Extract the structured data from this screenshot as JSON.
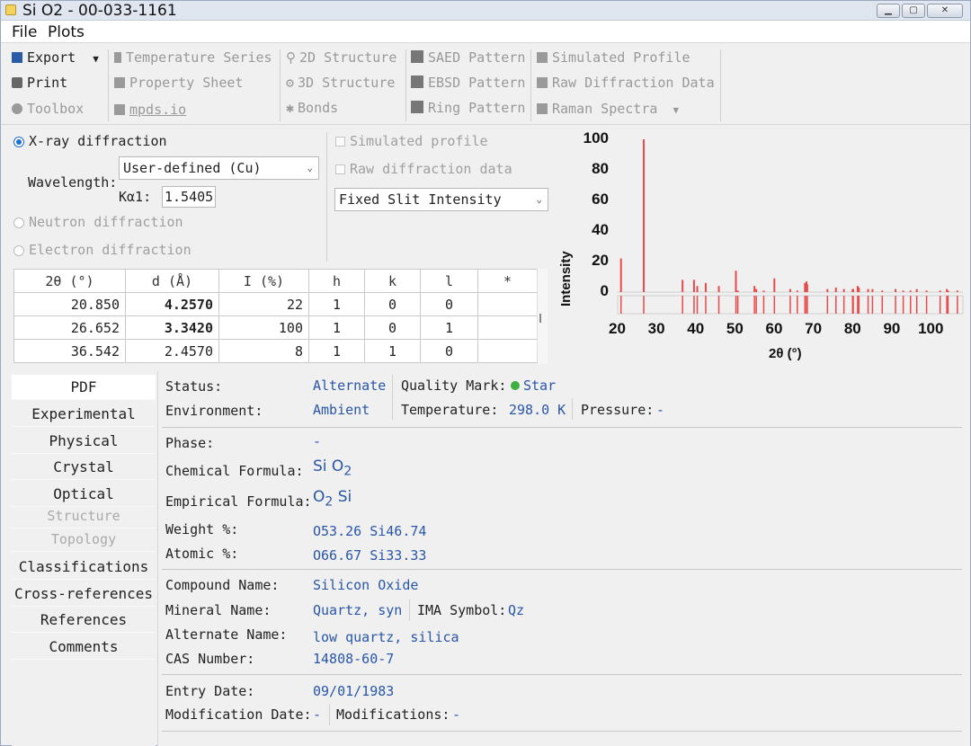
{
  "window": {
    "title": "Si O2 - 00-033-1161"
  },
  "menu": {
    "file": "File",
    "plots": "Plots"
  },
  "toolbar": {
    "export": "Export",
    "print": "Print",
    "toolbox": "Toolbox",
    "temperature_series": "Temperature Series",
    "property_sheet": "Property Sheet",
    "mpds": "mpds.io",
    "structure_2d": "2D Structure",
    "structure_3d": "3D Structure",
    "bonds": "Bonds",
    "saed": "SAED Pattern",
    "ebsd": "EBSD Pattern",
    "ring": "Ring Pattern",
    "simulated_profile": "Simulated Profile",
    "raw_diffraction": "Raw Diffraction Data",
    "raman": "Raman Spectra"
  },
  "diffraction": {
    "xray": "X-ray diffraction",
    "wavelength_label": "Wavelength:",
    "wavelength_value": "User-defined (Cu)",
    "ka1_label": "Kα1:",
    "ka1_value": "1.5405",
    "neutron": "Neutron diffraction",
    "electron": "Electron diffraction",
    "sim_profile": "Simulated profile",
    "raw_data": "Raw diffraction data",
    "intensity_mode": "Fixed Slit Intensity"
  },
  "peaks": {
    "headers": [
      "2θ (°)",
      "d (Å)",
      "I (%)",
      "h",
      "k",
      "l",
      "*"
    ],
    "rows": [
      [
        "20.850",
        "4.2570",
        "22",
        "1",
        "0",
        "0",
        ""
      ],
      [
        "26.652",
        "3.3420",
        "100",
        "1",
        "0",
        "1",
        ""
      ],
      [
        "36.542",
        "2.4570",
        "8",
        "1",
        "1",
        "0",
        ""
      ]
    ]
  },
  "chart_data": {
    "type": "bar",
    "xlabel": "2θ (°)",
    "ylabel": "Intensity",
    "xlim": [
      20,
      108
    ],
    "ylim": [
      0,
      100
    ],
    "xticks": [
      20,
      30,
      40,
      50,
      60,
      70,
      80,
      90,
      100
    ],
    "yticks": [
      0,
      20,
      40,
      60,
      80,
      100
    ],
    "peaks": [
      {
        "x": 20.85,
        "y": 22
      },
      {
        "x": 26.65,
        "y": 100
      },
      {
        "x": 36.54,
        "y": 8
      },
      {
        "x": 39.46,
        "y": 8
      },
      {
        "x": 40.29,
        "y": 4
      },
      {
        "x": 42.45,
        "y": 6
      },
      {
        "x": 45.79,
        "y": 4
      },
      {
        "x": 50.14,
        "y": 14
      },
      {
        "x": 50.62,
        "y": 1
      },
      {
        "x": 54.87,
        "y": 4
      },
      {
        "x": 55.32,
        "y": 2
      },
      {
        "x": 57.23,
        "y": 1
      },
      {
        "x": 59.95,
        "y": 9
      },
      {
        "x": 63.99,
        "y": 2
      },
      {
        "x": 65.79,
        "y": 1
      },
      {
        "x": 67.74,
        "y": 6
      },
      {
        "x": 68.14,
        "y": 7
      },
      {
        "x": 68.32,
        "y": 5
      },
      {
        "x": 73.47,
        "y": 2
      },
      {
        "x": 75.64,
        "y": 3
      },
      {
        "x": 77.67,
        "y": 2
      },
      {
        "x": 79.88,
        "y": 2
      },
      {
        "x": 80.04,
        "y": 2
      },
      {
        "x": 81.17,
        "y": 4
      },
      {
        "x": 81.49,
        "y": 3
      },
      {
        "x": 83.84,
        "y": 2
      },
      {
        "x": 84.95,
        "y": 2
      },
      {
        "x": 87.44,
        "y": 1
      },
      {
        "x": 90.83,
        "y": 2
      },
      {
        "x": 92.79,
        "y": 1
      },
      {
        "x": 94.65,
        "y": 1
      },
      {
        "x": 96.24,
        "y": 2
      },
      {
        "x": 98.74,
        "y": 1
      },
      {
        "x": 102.2,
        "y": 1
      },
      {
        "x": 103.9,
        "y": 2
      },
      {
        "x": 104.2,
        "y": 1
      },
      {
        "x": 106.6,
        "y": 1
      }
    ],
    "bar_color": "#e84a4a"
  },
  "tabs": {
    "pdf": "PDF",
    "experimental": "Experimental",
    "physical": "Physical",
    "crystal": "Crystal",
    "optical": "Optical",
    "structure": "Structure",
    "topology": "Topology",
    "classifications": "Classifications",
    "cross_references": "Cross-references",
    "references": "References",
    "comments": "Comments"
  },
  "pdf": {
    "status_label": "Status:",
    "status_value": "Alternate",
    "quality_label": "Quality Mark:",
    "quality_value": "Star",
    "environment_label": "Environment:",
    "environment_value": "Ambient",
    "temperature_label": "Temperature:",
    "temperature_value": "298.0 K",
    "pressure_label": "Pressure:",
    "pressure_value": "-",
    "phase_label": "Phase:",
    "phase_value": "-",
    "chemical_label": "Chemical Formula:",
    "chemical_a": "Si O",
    "chemical_a_sub": "2",
    "empirical_label": "Empirical Formula:",
    "empirical_a": "O",
    "empirical_a_sub": "2",
    "empirical_b": " Si",
    "weight_label": "Weight %:",
    "weight_value": "O53.26 Si46.74",
    "atomic_label": "Atomic %:",
    "atomic_value": "O66.67 Si33.33",
    "compound_label": "Compound Name:",
    "compound_value": "Silicon Oxide",
    "mineral_label": "Mineral Name:",
    "mineral_value": "Quartz, syn",
    "ima_label": "IMA Symbol:",
    "ima_value": "Qz",
    "alternate_label": "Alternate Name:",
    "alternate_value": "low quartz, silica",
    "cas_label": "CAS Number:",
    "cas_value": "14808-60-7",
    "entry_label": "Entry Date:",
    "entry_value": "09/01/1983",
    "modification_label": "Modification Date:",
    "modification_value": "-",
    "modifications_label": "Modifications:",
    "modifications_value": "-"
  }
}
